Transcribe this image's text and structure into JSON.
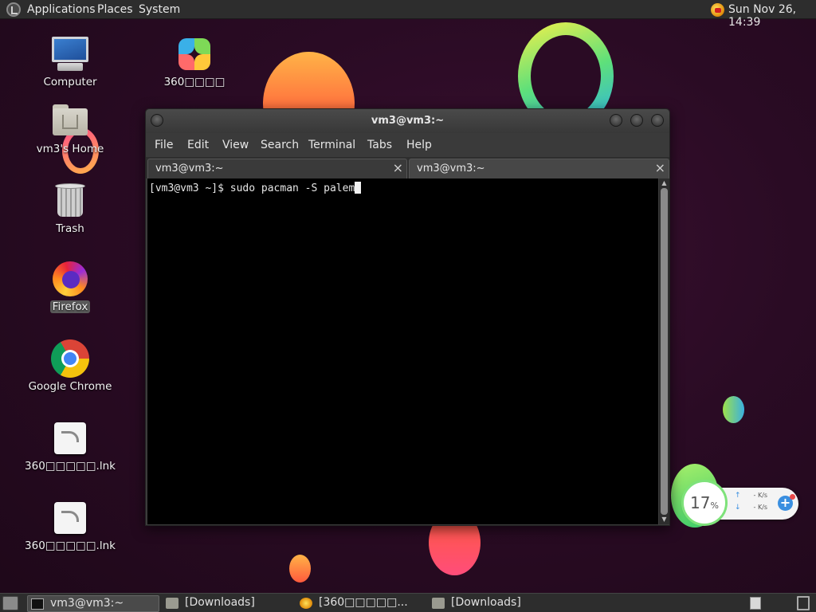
{
  "top_panel": {
    "menus": [
      "Applications",
      "Places",
      "System"
    ],
    "clock": "Sun Nov 26, 14:39"
  },
  "desktop_icons": [
    {
      "label": "Computer",
      "icon": "computer-icon"
    },
    {
      "label": "360□□□□",
      "icon": "360-logo-icon"
    },
    {
      "label": "vm3's Home",
      "icon": "home-folder-icon"
    },
    {
      "label": "Trash",
      "icon": "trash-icon"
    },
    {
      "label": "Firefox",
      "icon": "firefox-icon"
    },
    {
      "label": "Google Chrome",
      "icon": "chrome-icon"
    },
    {
      "label": "360□□□□□.lnk",
      "icon": "shortcut-icon"
    },
    {
      "label": "360□□□□□.lnk",
      "icon": "shortcut-icon"
    }
  ],
  "terminal": {
    "title": "vm3@vm3:~",
    "menu": [
      "File",
      "Edit",
      "View",
      "Search",
      "Terminal",
      "Tabs",
      "Help"
    ],
    "tabs": [
      {
        "label": "vm3@vm3:~",
        "close": "×"
      },
      {
        "label": "vm3@vm3:~",
        "close": "×"
      }
    ],
    "prompt": "[vm3@vm3 ~]$ ",
    "command": "sudo pacman -S palem"
  },
  "net_widget": {
    "percent": "17",
    "percent_sign": "%",
    "upload": "- K/s",
    "download": "- K/s",
    "upload_arrow": "↑",
    "download_arrow": "↓",
    "boost": "+"
  },
  "taskbar": {
    "tasks": [
      {
        "label": "vm3@vm3:~",
        "icon": "terminal-icon",
        "active": true
      },
      {
        "label": "[Downloads]",
        "icon": "folder-icon",
        "active": false
      },
      {
        "label": "[360□□□□□...",
        "icon": "360-logo-icon",
        "active": false
      },
      {
        "label": "[Downloads]",
        "icon": "folder-icon",
        "active": false
      }
    ]
  },
  "colors": {
    "wallpaper": "#2a0b24",
    "panel": "#2d2d2d",
    "terminal_bg": "#000000",
    "accent_green": "#7ee27a",
    "accent_blue": "#3a8fe0"
  }
}
